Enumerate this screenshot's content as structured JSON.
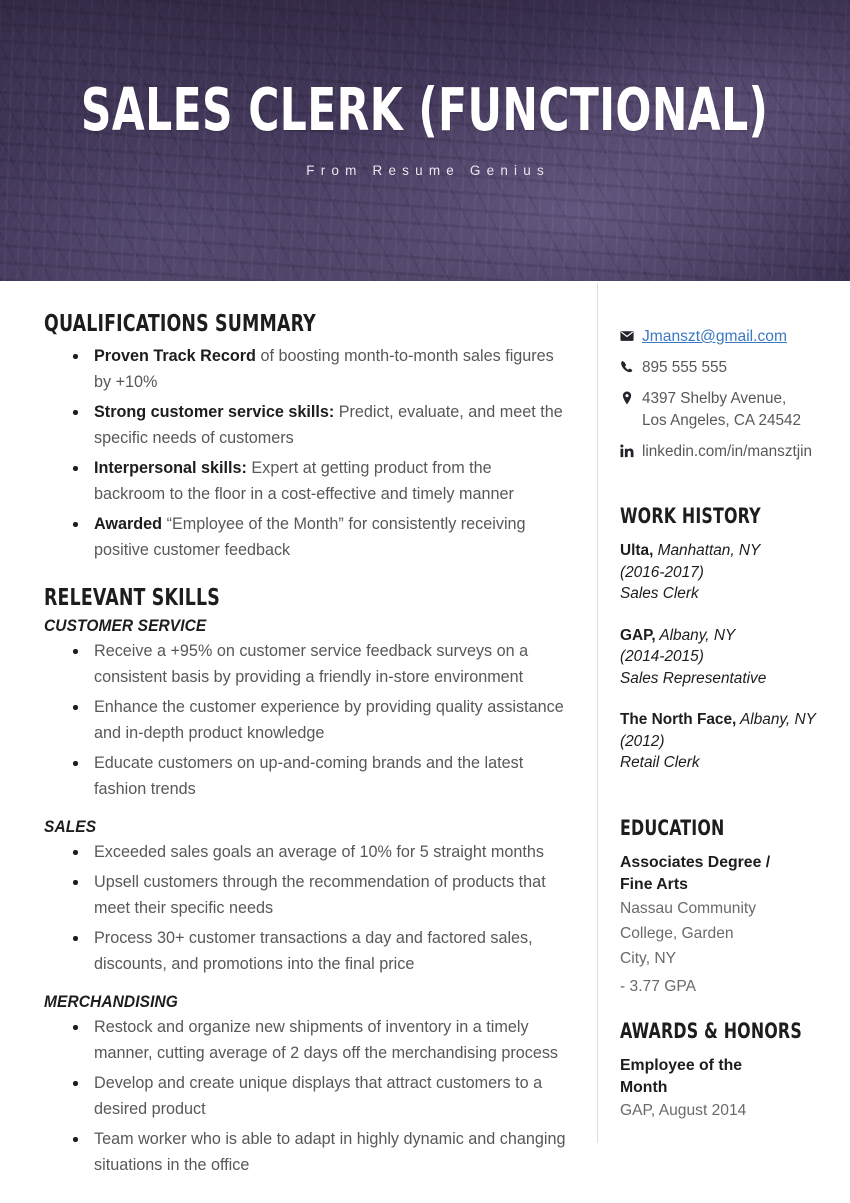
{
  "header": {
    "title": "SALES CLERK (FUNCTIONAL)",
    "subtitle": "From Resume Genius",
    "background_color": "#3a3050",
    "background_image": "city-skyline-aerial"
  },
  "main": {
    "qualifications": {
      "heading": "QUALIFICATIONS SUMMARY",
      "items": [
        {
          "lead": "Proven Track Record",
          "rest": " of boosting month-to-month sales figures by +10%"
        },
        {
          "lead": "Strong customer service skills:",
          "rest": " Predict, evaluate, and meet the specific needs of customers"
        },
        {
          "lead": "Interpersonal skills:",
          "rest": " Expert at getting product from the backroom to the floor in a cost-effective and timely manner"
        },
        {
          "lead": "Awarded",
          "rest": " “Employee of the Month” for consistently receiving positive customer feedback"
        }
      ]
    },
    "relevant_skills": {
      "heading": "RELEVANT SKILLS",
      "groups": [
        {
          "subheading": "CUSTOMER SERVICE",
          "items": [
            "Receive a +95% on customer service feedback surveys on a consistent basis by providing a friendly in-store environment",
            "Enhance the customer experience by providing quality assistance and in-depth product knowledge",
            "Educate customers on up-and-coming brands and the latest fashion trends"
          ]
        },
        {
          "subheading": "SALES",
          "items": [
            "Exceeded sales goals an average of 10% for 5 straight months",
            "Upsell customers through the recommendation of products that meet their specific needs",
            "Process 30+ customer transactions a day and factored sales, discounts, and promotions into the final price"
          ]
        },
        {
          "subheading": "MERCHANDISING",
          "items": [
            "Restock and organize new shipments of inventory in a timely manner, cutting average of 2 days off the merchandising process",
            "Develop and create unique displays that attract customers to a desired product",
            "Team worker who is able to adapt in highly dynamic and changing situations in the office"
          ]
        }
      ]
    }
  },
  "sidebar": {
    "contact": {
      "email": "Jmanszt@gmail.com",
      "email_color": "#3b78c3",
      "phone": "895 555 555",
      "address_line1": "4397 Shelby Avenue,",
      "address_line2": "Los Angeles, CA 24542",
      "linkedin": "linkedin.com/in/mansztjin",
      "icons": {
        "email": "envelope-icon",
        "phone": "phone-icon",
        "address": "map-pin-icon",
        "linkedin": "linkedin-icon"
      }
    },
    "work_history": {
      "heading": "WORK HISTORY",
      "entries": [
        {
          "company": "Ulta,",
          "location": " Manhattan, NY",
          "dates": "(2016-2017)",
          "role": "Sales Clerk"
        },
        {
          "company": "GAP,",
          "location": " Albany, NY",
          "dates": "(2014-2015)",
          "role": "Sales Representative"
        },
        {
          "company": "The North Face,",
          "location": " Albany, NY",
          "dates": "(2012)",
          "role": "Retail Clerk"
        }
      ]
    },
    "education": {
      "heading": "EDUCATION",
      "degree_line1": "Associates Degree /",
      "degree_line2": "Fine Arts",
      "school_line1": "Nassau Community",
      "school_line2": "College, Garden",
      "school_line3": "City, NY",
      "gpa": "- 3.77 GPA"
    },
    "awards": {
      "heading": "AWARDS & HONORS",
      "title_line1": "Employee of the",
      "title_line2": "Month",
      "detail": "GAP, August 2014"
    }
  }
}
